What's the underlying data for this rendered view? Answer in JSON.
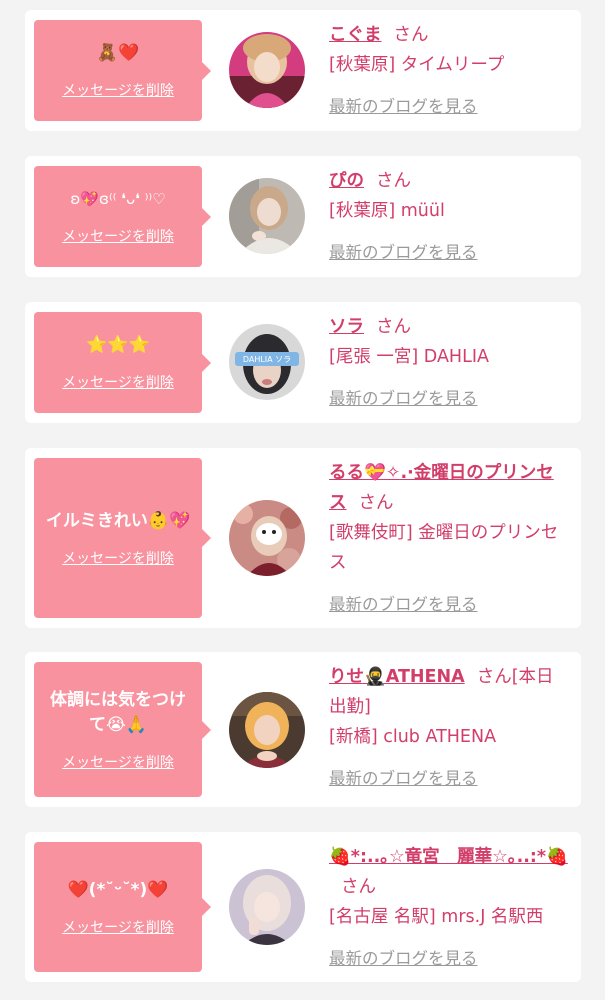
{
  "entries": [
    {
      "message": "🧸❤️",
      "delete_label": "メッセージを削除",
      "name": "こぐま",
      "suffix": "さん",
      "shop": "[秋葉原] タイムリープ",
      "blog_label": "最新のブログを見る"
    },
    {
      "message": "ʚ💖ɞ⁽⁽ ❛ᴗ❛ ⁾⁾♡",
      "delete_label": "メッセージを削除",
      "name": "ぴの",
      "suffix": "さん",
      "shop": "[秋葉原] müül",
      "blog_label": "最新のブログを見る"
    },
    {
      "message": "⭐⭐⭐",
      "delete_label": "メッセージを削除",
      "name": "ソラ",
      "suffix": "さん",
      "shop": "[尾張 一宮] DAHLIA",
      "blog_label": "最新のブログを見る",
      "avatar_badge": "DAHLIA ソラ"
    },
    {
      "message": "イルミきれい👶💖",
      "delete_label": "メッセージを削除",
      "name": "るる💝✧.·金曜日のプリンセス",
      "suffix": "さん",
      "shop": "[歌舞伎町] 金曜日のプリンセス",
      "blog_label": "最新のブログを見る"
    },
    {
      "message": "体調には気をつけて😭🙏",
      "delete_label": "メッセージを削除",
      "name": "りせ🥷ATHENA",
      "suffix": "さん[本日出勤]",
      "shop": "[新橋] club ATHENA",
      "blog_label": "最新のブログを見る"
    },
    {
      "message": "❤️(*˘ᵕ˘*)❤️",
      "delete_label": "メッセージを削除",
      "name": "🍓*:..｡☆竜宮　麗華☆｡..:*🍓",
      "suffix": "さん",
      "shop": "[名古屋 名駅] mrs.J 名駅西",
      "blog_label": "最新のブログを見る"
    }
  ],
  "colors": {
    "accent": "#d23e6a",
    "message_bg": "#f9929f",
    "card_bg": "#ffffff",
    "page_bg": "#f3f3f3",
    "link_gray": "#9a9a9a"
  }
}
